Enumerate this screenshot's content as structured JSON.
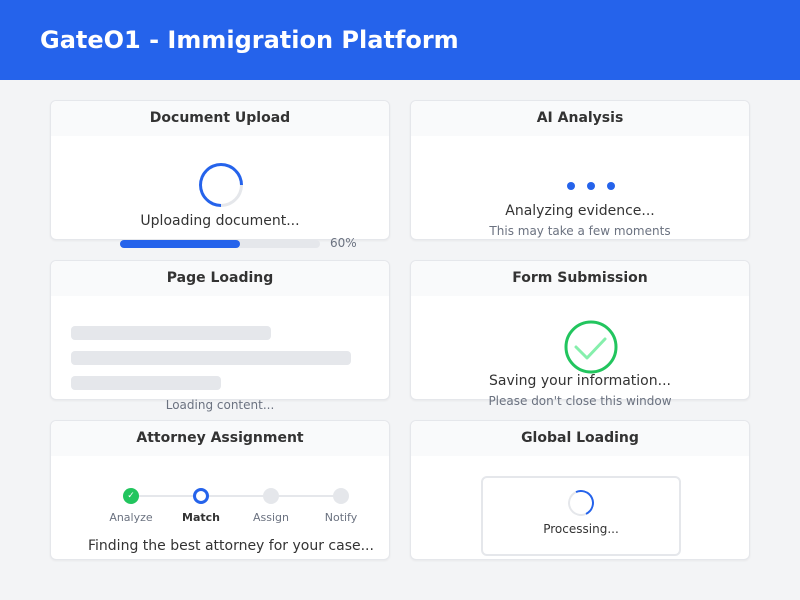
{
  "header": {
    "title": "GateO1 - Immigration Platform"
  },
  "colors": {
    "brand": "#2563eb",
    "success": "#22c55e",
    "muted": "#e5e7eb"
  },
  "cards": {
    "upload": {
      "title": "Document Upload",
      "message": "Uploading document...",
      "progress_percent": 60,
      "progress_label": "60%"
    },
    "ai": {
      "title": "AI Analysis",
      "message": "Analyzing evidence...",
      "sub": "This may take a few moments"
    },
    "page_loading": {
      "title": "Page Loading",
      "message": "Loading content..."
    },
    "form": {
      "title": "Form Submission",
      "message": "Saving your information...",
      "sub": "Please don't close this window"
    },
    "attorney": {
      "title": "Attorney Assignment",
      "steps": [
        {
          "label": "Analyze",
          "state": "done",
          "icon": "check-icon",
          "glyph": "✓"
        },
        {
          "label": "Match",
          "state": "active"
        },
        {
          "label": "Assign",
          "state": "pending"
        },
        {
          "label": "Notify",
          "state": "pending"
        }
      ],
      "message": "Finding the best attorney for your case..."
    },
    "global": {
      "title": "Global Loading",
      "message": "Processing..."
    }
  }
}
